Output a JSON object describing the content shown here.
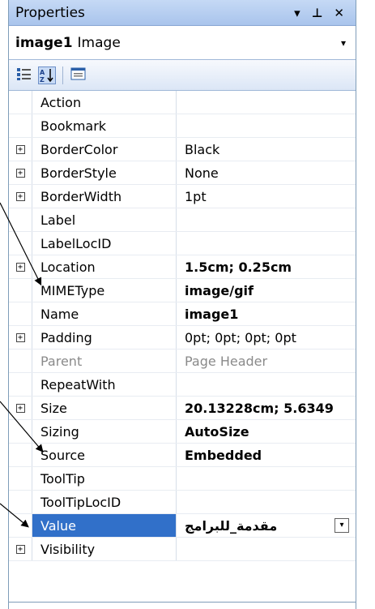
{
  "panel": {
    "title": "Properties",
    "controls": [
      "▾",
      "⊥",
      "✕"
    ]
  },
  "object_selector": {
    "name": "image1",
    "type": "Image",
    "dropdown": "▾"
  },
  "toolbar": {
    "categorized_icon": "categorized-icon",
    "alphabetical_icon": "alphabetical-icon",
    "property_pages_icon": "property-pages-icon"
  },
  "properties": [
    {
      "name": "Action",
      "value": "",
      "expand": false,
      "style": ""
    },
    {
      "name": "Bookmark",
      "value": "",
      "expand": false,
      "style": ""
    },
    {
      "name": "BorderColor",
      "value": "Black",
      "expand": true,
      "style": ""
    },
    {
      "name": "BorderStyle",
      "value": "None",
      "expand": true,
      "style": ""
    },
    {
      "name": "BorderWidth",
      "value": "1pt",
      "expand": true,
      "style": ""
    },
    {
      "name": "Label",
      "value": "",
      "expand": false,
      "style": ""
    },
    {
      "name": "LabelLocID",
      "value": "",
      "expand": false,
      "style": ""
    },
    {
      "name": "Location",
      "value": "1.5cm; 0.25cm",
      "expand": true,
      "style": "bold"
    },
    {
      "name": "MIMEType",
      "value": "image/gif",
      "expand": false,
      "style": "bold"
    },
    {
      "name": "Name",
      "value": "image1",
      "expand": false,
      "style": "bold"
    },
    {
      "name": "Padding",
      "value": "0pt; 0pt; 0pt; 0pt",
      "expand": true,
      "style": ""
    },
    {
      "name": "Parent",
      "value": "Page Header",
      "expand": false,
      "style": "grey"
    },
    {
      "name": "RepeatWith",
      "value": "",
      "expand": false,
      "style": ""
    },
    {
      "name": "Size",
      "value": "20.13228cm; 5.6349",
      "expand": true,
      "style": "bold"
    },
    {
      "name": "Sizing",
      "value": "AutoSize",
      "expand": false,
      "style": "bold"
    },
    {
      "name": "Source",
      "value": "Embedded",
      "expand": false,
      "style": "bold"
    },
    {
      "name": "ToolTip",
      "value": "",
      "expand": false,
      "style": ""
    },
    {
      "name": "ToolTipLocID",
      "value": "",
      "expand": false,
      "style": ""
    },
    {
      "name": "Value",
      "value": "مقدمة_للبرامج",
      "expand": false,
      "style": "selected"
    },
    {
      "name": "Visibility",
      "value": "",
      "expand": true,
      "style": ""
    }
  ],
  "expand_glyph": "+",
  "value_dropdown": "▾",
  "colors": {
    "selection": "#3170c9",
    "title_bar": "#b7cff0",
    "arrow": "#000000"
  }
}
